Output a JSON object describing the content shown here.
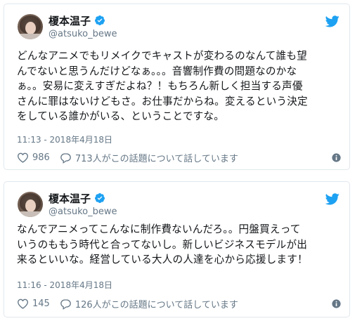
{
  "tweets": [
    {
      "author": {
        "display_name": "榎本温子",
        "handle": "@atsuko_bewe",
        "verified": true
      },
      "text": "どんなアニメでもリメイクでキャストが変わるのなんて誰も望\nんでないと思うんだけどなぁ。。。音響制作費の問題なのかな\nぁ。。安易に変えすぎだよね？！もちろん新しく担当する声優\nさんに罪はないけどもさ。お仕事だからね。変えるという決定\nをしている誰かがいる、ということですな。",
      "timestamp": "11:13 - 2018年4月18日",
      "likes": "986",
      "replies_text": "713人がこの話題について話しています"
    },
    {
      "author": {
        "display_name": "榎本温子",
        "handle": "@atsuko_bewe",
        "verified": true
      },
      "text": "なんでアニメってこんなに制作費ないんだろ。。円盤買えって\nいうのももう時代と合ってないし。新しいビジネスモデルが出\n来るといいな。経営している大人の人達を心から応援します！",
      "timestamp": "11:16 - 2018年4月18日",
      "likes": "145",
      "replies_text": "126人がこの話題について話しています"
    }
  ],
  "colors": {
    "twitter_blue": "#1da1f2",
    "text": "#14171a",
    "secondary": "#657786",
    "border": "#e1e8ed"
  },
  "icons": {
    "verified": "verified-badge-icon",
    "logo": "twitter-bird-icon",
    "like": "heart-icon",
    "reply": "speech-bubble-icon",
    "info": "info-icon"
  }
}
